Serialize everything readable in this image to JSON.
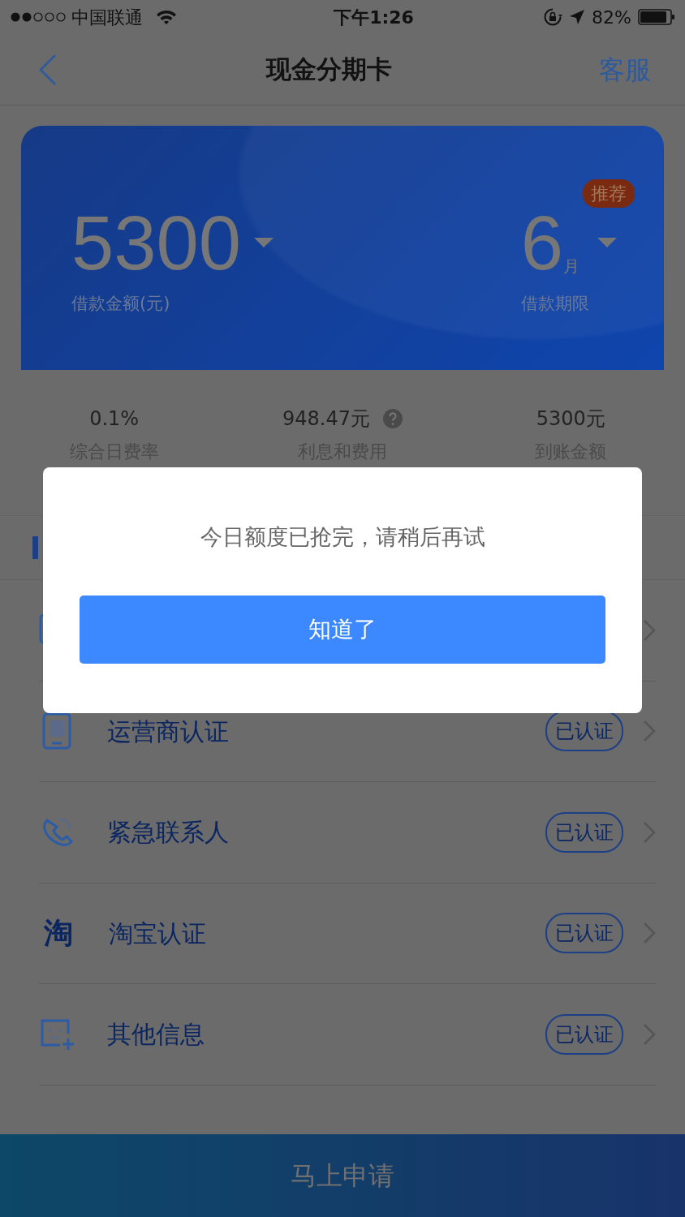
{
  "status_bar": {
    "carrier": "中国联通",
    "time": "下午1:26",
    "battery": "82%"
  },
  "nav": {
    "title": "现金分期卡",
    "action": "客服"
  },
  "loan_card": {
    "amount": "5300",
    "amount_label": "借款金额(元)",
    "term": "6",
    "term_unit": "月",
    "term_label": "借款期限",
    "badge": "推荐"
  },
  "stats": [
    {
      "value": "0.1%",
      "label": "综合日费率",
      "help": false
    },
    {
      "value": "948.47元",
      "label": "利息和费用",
      "help": true
    },
    {
      "value": "5300元",
      "label": "到账金额",
      "help": false
    }
  ],
  "verifications": [
    {
      "kind": "card"
    },
    {
      "kind": "phone",
      "title": "运营商认证",
      "status": "已认证"
    },
    {
      "kind": "contact",
      "title": "紧急联系人",
      "status": "已认证"
    },
    {
      "kind": "glyph",
      "glyph": "淘",
      "title": "淘宝认证",
      "status": "已认证"
    },
    {
      "kind": "profile",
      "title": "其他信息",
      "status": "已认证"
    }
  ],
  "dialog": {
    "message": "今日额度已抢完，请稍后再试",
    "button": "知道了"
  },
  "apply_button": "马上申请"
}
